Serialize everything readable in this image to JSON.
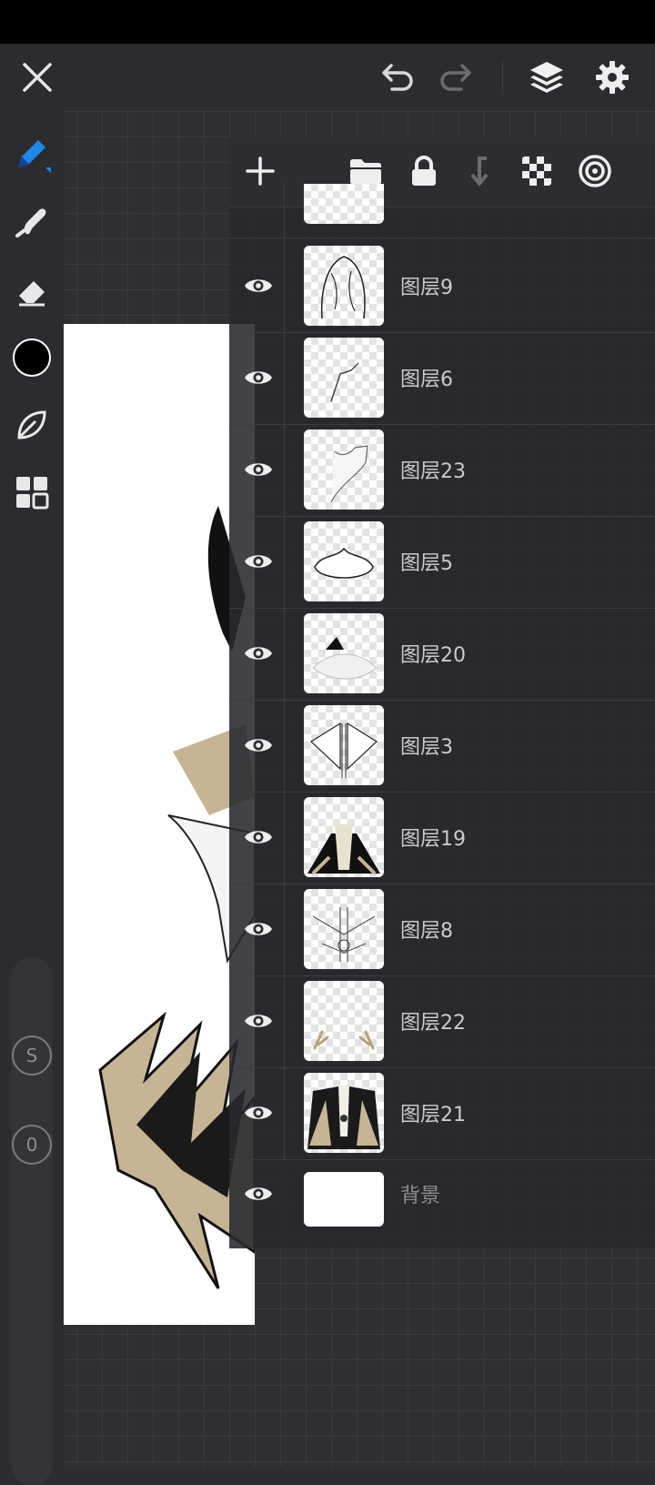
{
  "colors": {
    "accent": "#1e88e5",
    "background": "#2b2c2f",
    "brush_color": "#000000"
  },
  "top_bar": {
    "close_icon": "close-icon",
    "undo_icon": "undo-icon",
    "redo_icon": "redo-icon",
    "layers_icon": "layers-icon",
    "settings_icon": "gear-icon"
  },
  "left_toolbar": {
    "tools": [
      "pen-icon",
      "smudge-icon",
      "eraser-icon",
      "color-swatch",
      "leaf-icon",
      "grid-icon"
    ],
    "size_badge": "S",
    "opacity_badge": "0"
  },
  "layer_toolbar": {
    "add_icon": "plus-icon",
    "folder_icon": "folder-icon",
    "lock_icon": "lock-icon",
    "merge_down_icon": "merge-down-icon",
    "transparency_icon": "checkerboard-icon",
    "blend_icon": "blend-icon"
  },
  "layers": [
    {
      "name": "图层9"
    },
    {
      "name": "图层6"
    },
    {
      "name": "图层23"
    },
    {
      "name": "图层5"
    },
    {
      "name": "图层20"
    },
    {
      "name": "图层3"
    },
    {
      "name": "图层19"
    },
    {
      "name": "图层8"
    },
    {
      "name": "图层22"
    },
    {
      "name": "图层21"
    }
  ],
  "background_layer": {
    "name": "背景"
  }
}
